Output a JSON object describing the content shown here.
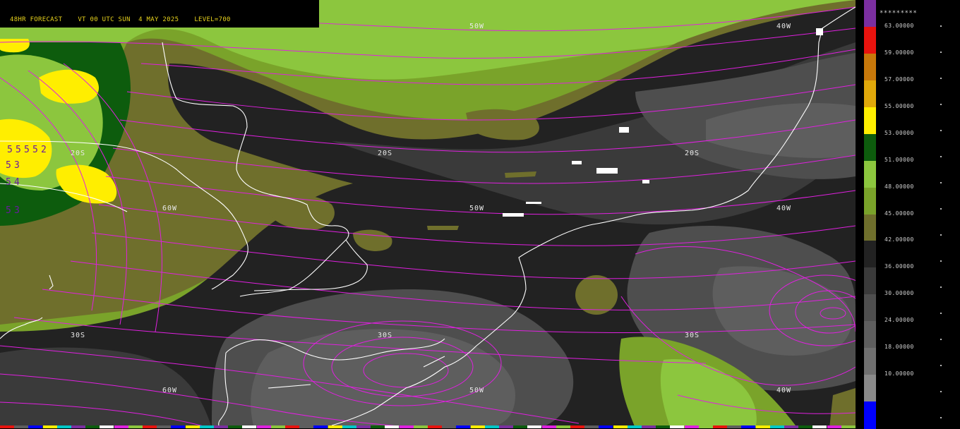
{
  "header": {
    "forecast": "48HR FORECAST",
    "valid_time": "VT 00 UTC SUN  4 MAY 2025",
    "level": "LEVEL=700"
  },
  "grid_labels": {
    "lat_20s": "20S",
    "lat_30s": "30S",
    "lon_60w": "60W",
    "lon_50w": "50W",
    "lon_40w": "40W"
  },
  "contour_numbers": [
    "5",
    "5",
    "5",
    "5",
    "2",
    "5",
    "3",
    "5",
    "4",
    "5",
    "3"
  ],
  "colorbar": {
    "top_label": "*********",
    "colors": {
      "purple": "#7b2fa0",
      "red": "#e8130e",
      "dark_orange": "#c8780a",
      "orange": "#e0a80a",
      "yellow": "#ffee00",
      "dark_green": "#0d5c0d",
      "light_green": "#8cc63e",
      "olive_green": "#7aa32a",
      "olive": "#6f6f2c",
      "dark_gray": "#222222",
      "gray1": "#3a3a3a",
      "gray2": "#4e4e4e",
      "gray3": "#5e5e5e",
      "gray4": "#707070",
      "gray5": "#8a8a8a",
      "blue": "#0000ff"
    },
    "segments": [
      "purple",
      "red",
      "dark_orange",
      "orange",
      "yellow",
      "dark_green",
      "light_green",
      "olive_green",
      "olive",
      "dark_gray",
      "gray1",
      "gray2",
      "gray3",
      "gray4",
      "gray5",
      "blue"
    ],
    "labels": [
      "63.00000",
      "59.00000",
      "57.00000",
      "55.00000",
      "53.00000",
      "51.00000",
      "48.00000",
      "45.00000",
      "42.00000",
      "36.00000",
      "30.00000",
      "24.00000",
      "18.00000",
      "10.00000"
    ]
  },
  "streamline_color": "#e020e0",
  "coastline_color": "#ffffff"
}
